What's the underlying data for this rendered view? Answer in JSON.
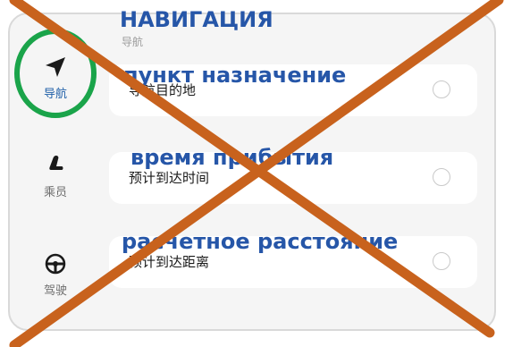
{
  "sidebar": {
    "items": [
      {
        "label": "导航",
        "icon": "navigation-arrow-icon",
        "active": true
      },
      {
        "label": "乘员",
        "icon": "car-seat-icon",
        "active": false
      },
      {
        "label": "驾驶",
        "icon": "steering-wheel-icon",
        "active": false
      }
    ]
  },
  "main": {
    "section_title": "导航",
    "options": [
      {
        "label": "导航目的地",
        "annotation": "пункт назначение"
      },
      {
        "label": "预计到达时间",
        "annotation": "время прибытия"
      },
      {
        "label": "预计到达距离",
        "annotation": "расчетное расстояние"
      }
    ]
  },
  "annotations": {
    "heading": "НАВИГАЦИЯ"
  },
  "colors": {
    "accent_blue": "#1f5fa8",
    "annotation_blue": "#2656a8",
    "highlight_green": "#1aa44a",
    "cross_orange": "#c8621d"
  }
}
